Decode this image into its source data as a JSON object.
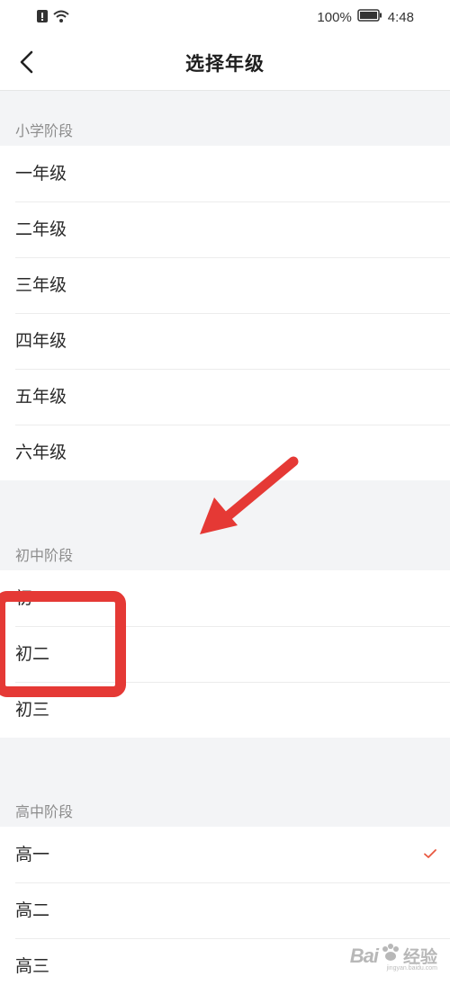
{
  "status_bar": {
    "battery": "100%",
    "time": "4:48"
  },
  "header": {
    "title": "选择年级"
  },
  "sections": [
    {
      "label": "小学阶段",
      "items": [
        "一年级",
        "二年级",
        "三年级",
        "四年级",
        "五年级",
        "六年级"
      ]
    },
    {
      "label": "初中阶段",
      "items": [
        "初一",
        "初二",
        "初三"
      ]
    },
    {
      "label": "高中阶段",
      "items": [
        "高一",
        "高二",
        "高三"
      ],
      "selected": "高一"
    }
  ],
  "accent_color": "#e8573f",
  "annotation_color": "#e53935",
  "watermark": {
    "brand": "Bai",
    "brand_cn": "经验",
    "sub": "jingyan.baidu.com"
  }
}
